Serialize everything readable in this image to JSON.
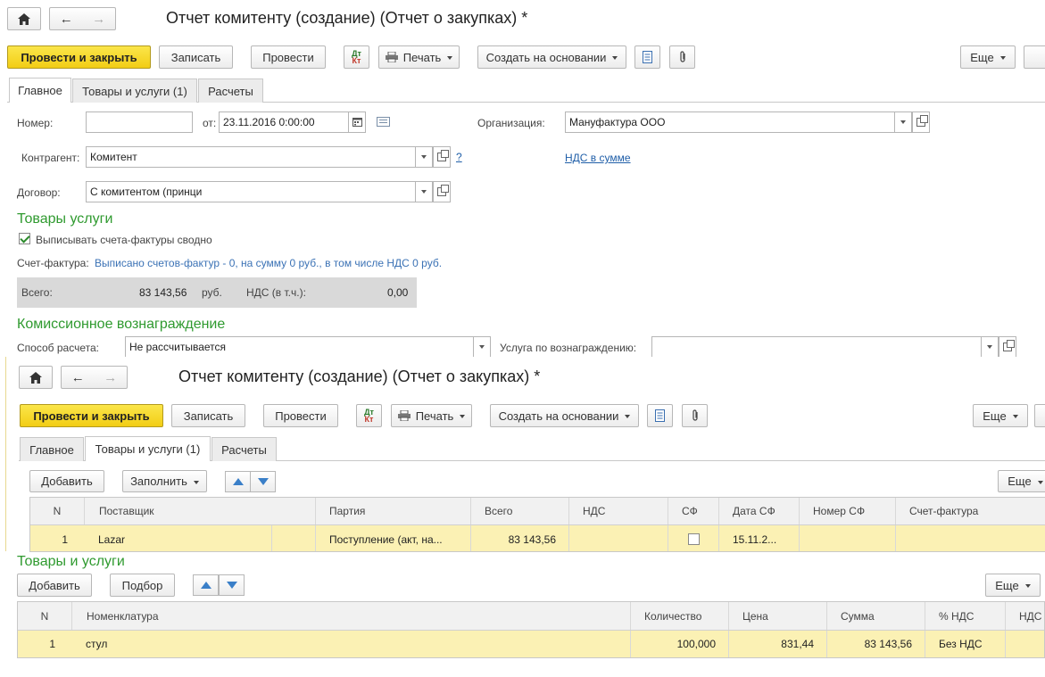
{
  "window1": {
    "title": "Отчет комитенту (создание) (Отчет о закупках) *",
    "toolbar": {
      "post_close": "Провести и закрыть",
      "save": "Записать",
      "post": "Провести",
      "print": "Печать",
      "create_based": "Создать на основании",
      "more": "Еще"
    },
    "tabs": [
      "Главное",
      "Товары и услуги (1)",
      "Расчеты"
    ],
    "form": {
      "number_label": "Номер:",
      "number_value": "",
      "from_label": "от:",
      "date_value": "23.11.2016  0:00:00",
      "org_label": "Организация:",
      "org_value": "Мануфактура ООО",
      "contractor_label": "Контрагент:",
      "contractor_value": "Комитент",
      "help": "?",
      "vat_link": "НДС в сумме",
      "contract_label": "Договор:",
      "contract_value": "С комитентом (принци",
      "section_goods": "Товары услуги",
      "invoice_consolidated_label": "Выписывать счета-фактуры сводно",
      "invoice_consolidated": true,
      "invoice_label": "Счет-фактура:",
      "invoice_info": "Выписано счетов-фактур - 0, на сумму 0 руб., в том числе НДС 0 руб.",
      "total_label": "Всего:",
      "total_value": "83 143,56",
      "currency": "руб.",
      "vat_incl_label": "НДС (в т.ч.):",
      "vat_incl_value": "0,00",
      "section_commission": "Комиссионное вознаграждение",
      "calc_method_label": "Способ расчета:",
      "calc_method_value": "Не рассчитывается",
      "reward_service_label": "Услуга по вознаграждению:",
      "reward_service_value": ""
    }
  },
  "window2": {
    "title": "Отчет комитенту (создание) (Отчет о закупках) *",
    "toolbar": {
      "post_close": "Провести и закрыть",
      "save": "Записать",
      "post": "Провести",
      "print": "Печать",
      "create_based": "Создать на основании",
      "more": "Еще"
    },
    "tabs": [
      "Главное",
      "Товары и услуги (1)",
      "Расчеты"
    ],
    "grid_toolbar": {
      "add": "Добавить",
      "fill": "Заполнить",
      "more": "Еще"
    },
    "grid": {
      "columns": [
        "N",
        "Поставщик",
        "",
        "Партия",
        "Всего",
        "НДС",
        "СФ",
        "Дата СФ",
        "Номер СФ",
        "Счет-фактура"
      ],
      "rows": [
        {
          "n": "1",
          "supplier": "Lazar",
          "blank": "",
          "batch": "Поступление (акт, на...",
          "total": "83 143,56",
          "vat": "",
          "sf": false,
          "sf_date": "15.11.2...",
          "sf_number": "",
          "invoice": ""
        }
      ]
    }
  },
  "goods": {
    "section_title": "Товары и услуги",
    "toolbar": {
      "add": "Добавить",
      "pick": "Подбор",
      "more": "Еще"
    },
    "columns": [
      "N",
      "Номенклатура",
      "Количество",
      "Цена",
      "Сумма",
      "% НДС",
      "НДС"
    ],
    "rows": [
      {
        "n": "1",
        "item": "стул",
        "qty": "100,000",
        "price": "831,44",
        "sum": "83 143,56",
        "vat_rate": "Без НДС",
        "vat": ""
      }
    ]
  }
}
